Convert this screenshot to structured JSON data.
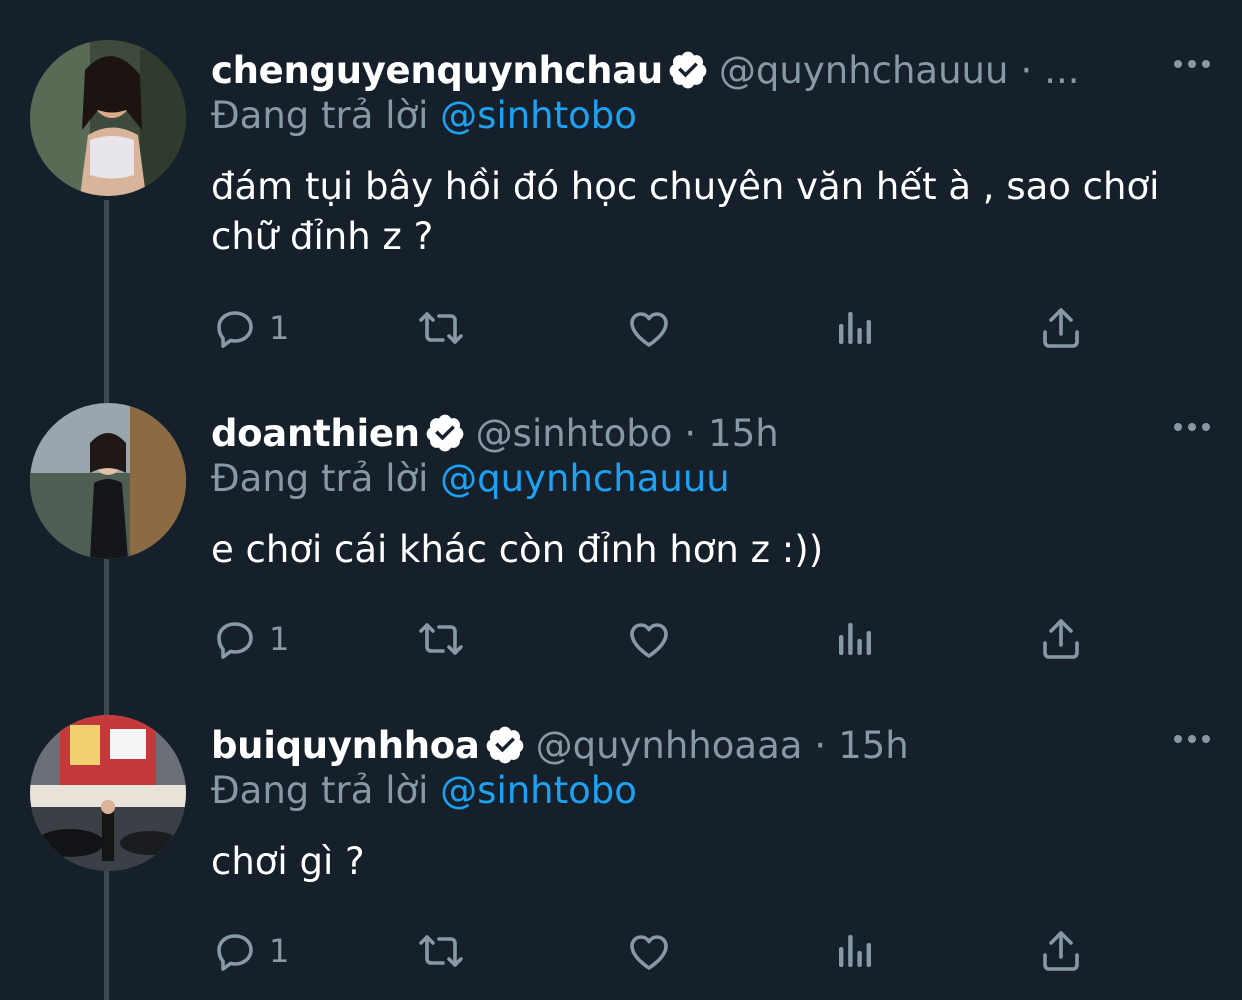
{
  "tweets": [
    {
      "display_name": "chenguyenquynhchau",
      "handle": "@quynhchauuu",
      "separator": "·",
      "time": "...",
      "reply_label": "Đang trả lời",
      "reply_to": "@sinhtobo",
      "text": "đám tụi bây hồi đó học chuyên văn hết à , sao chơi chữ đỉnh z ?",
      "reply_count": "1"
    },
    {
      "display_name": "doanthien",
      "handle": "@sinhtobo",
      "separator": "·",
      "time": "15h",
      "reply_label": "Đang trả lời",
      "reply_to": "@quynhchauuu",
      "text": "e chơi cái khác còn đỉnh hơn z :))",
      "reply_count": "1"
    },
    {
      "display_name": "buiquynhhoa",
      "handle": "@quynhhoaaa",
      "separator": "·",
      "time": "15h",
      "reply_label": "Đang trả lời",
      "reply_to": "@sinhtobo",
      "text": "chơi gì ?",
      "reply_count": "1"
    }
  ],
  "icons": {
    "verified": "verified-badge-icon",
    "more": "more-dots-icon",
    "reply": "reply-icon",
    "retweet": "retweet-icon",
    "like": "heart-icon",
    "analytics": "analytics-icon",
    "share": "share-icon"
  },
  "colors": {
    "background": "#15202b",
    "text": "#ffffff",
    "muted": "#8899a6",
    "link": "#1da1f2",
    "thread_line": "#3d4a56"
  }
}
